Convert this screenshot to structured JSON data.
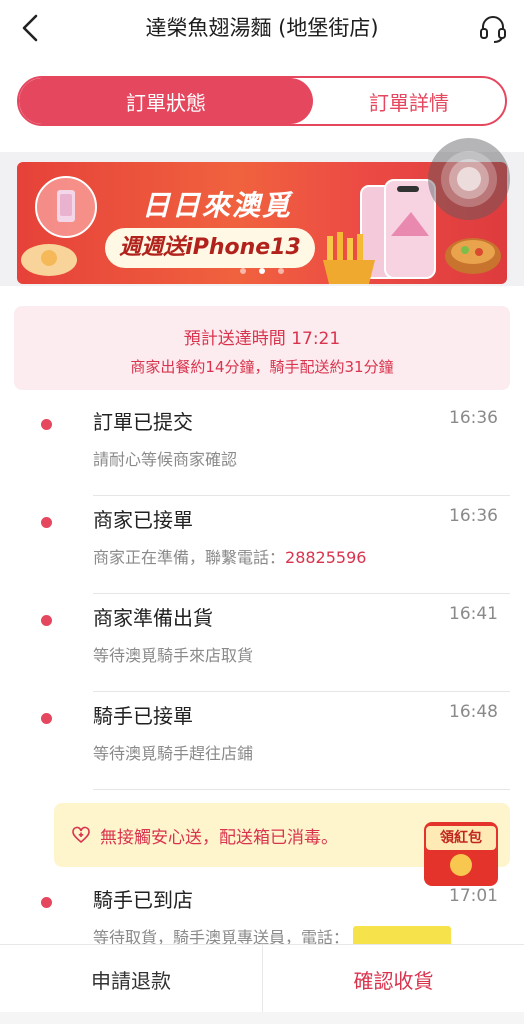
{
  "header": {
    "title": "達榮魚翅湯麵 (地堡街店)"
  },
  "segment": {
    "tabs": [
      {
        "label": "訂單狀態",
        "active": true
      },
      {
        "label": "訂單詳情",
        "active": false
      }
    ]
  },
  "banner": {
    "line1": "日日來澳覓",
    "line2": "週週送iPhone13"
  },
  "eta": {
    "title": "預計送達時間 17:21",
    "subtitle": "商家出餐約14分鐘，騎手配送約31分鐘"
  },
  "timeline": [
    {
      "title": "訂單已提交",
      "time": "16:36",
      "desc": "請耐心等候商家確認",
      "phone": ""
    },
    {
      "title": "商家已接單",
      "time": "16:36",
      "desc": "商家正在準備，聯繫電話：",
      "phone": "28825596"
    },
    {
      "title": "商家準備出貨",
      "time": "16:41",
      "desc": "等待澳覓騎手來店取貨",
      "phone": ""
    },
    {
      "title": "騎手已接單",
      "time": "16:48",
      "desc": "等待澳覓騎手趕往店鋪",
      "phone": ""
    },
    {
      "title": "騎手已到店",
      "time": "17:01",
      "desc": "等待取貨，騎手澳覓專送員，電話：",
      "phone": ""
    }
  ],
  "notice": {
    "text": "無接觸安心送，配送箱已消毒。"
  },
  "redpacket": {
    "label": "領紅包"
  },
  "bottom": {
    "refund_label": "申請退款",
    "confirm_label": "確認收貨"
  },
  "colors": {
    "accent": "#e5475f",
    "accent_text": "#d9344e",
    "notice_bg": "#fff5cc",
    "eta_bg": "#fdecef"
  }
}
